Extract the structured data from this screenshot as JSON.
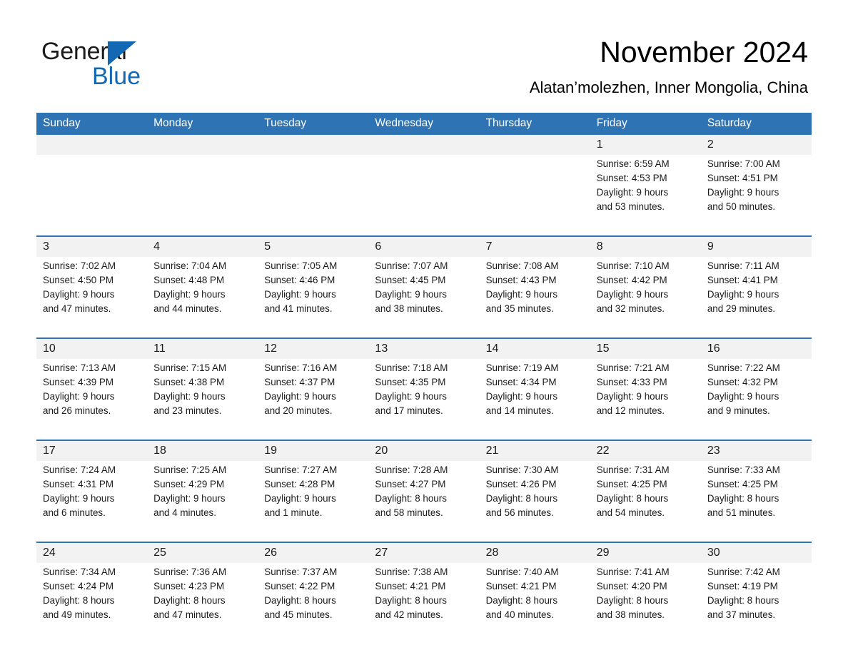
{
  "brand": {
    "name_part1": "General",
    "name_part2": "Blue",
    "accent_color": "#1268b3"
  },
  "header": {
    "title": "November 2024",
    "subtitle": "Alatan’molezhen, Inner Mongolia, China"
  },
  "colors": {
    "header_band": "#2e74b5",
    "date_band": "#f2f2f2",
    "text": "#1a1a1a"
  },
  "weekdays": [
    "Sunday",
    "Monday",
    "Tuesday",
    "Wednesday",
    "Thursday",
    "Friday",
    "Saturday"
  ],
  "weeks": [
    {
      "days": [
        {
          "date": "",
          "sunrise": "",
          "sunset": "",
          "daylight_line1": "",
          "daylight_line2": ""
        },
        {
          "date": "",
          "sunrise": "",
          "sunset": "",
          "daylight_line1": "",
          "daylight_line2": ""
        },
        {
          "date": "",
          "sunrise": "",
          "sunset": "",
          "daylight_line1": "",
          "daylight_line2": ""
        },
        {
          "date": "",
          "sunrise": "",
          "sunset": "",
          "daylight_line1": "",
          "daylight_line2": ""
        },
        {
          "date": "",
          "sunrise": "",
          "sunset": "",
          "daylight_line1": "",
          "daylight_line2": ""
        },
        {
          "date": "1",
          "sunrise": "Sunrise: 6:59 AM",
          "sunset": "Sunset: 4:53 PM",
          "daylight_line1": "Daylight: 9 hours",
          "daylight_line2": "and 53 minutes."
        },
        {
          "date": "2",
          "sunrise": "Sunrise: 7:00 AM",
          "sunset": "Sunset: 4:51 PM",
          "daylight_line1": "Daylight: 9 hours",
          "daylight_line2": "and 50 minutes."
        }
      ]
    },
    {
      "days": [
        {
          "date": "3",
          "sunrise": "Sunrise: 7:02 AM",
          "sunset": "Sunset: 4:50 PM",
          "daylight_line1": "Daylight: 9 hours",
          "daylight_line2": "and 47 minutes."
        },
        {
          "date": "4",
          "sunrise": "Sunrise: 7:04 AM",
          "sunset": "Sunset: 4:48 PM",
          "daylight_line1": "Daylight: 9 hours",
          "daylight_line2": "and 44 minutes."
        },
        {
          "date": "5",
          "sunrise": "Sunrise: 7:05 AM",
          "sunset": "Sunset: 4:46 PM",
          "daylight_line1": "Daylight: 9 hours",
          "daylight_line2": "and 41 minutes."
        },
        {
          "date": "6",
          "sunrise": "Sunrise: 7:07 AM",
          "sunset": "Sunset: 4:45 PM",
          "daylight_line1": "Daylight: 9 hours",
          "daylight_line2": "and 38 minutes."
        },
        {
          "date": "7",
          "sunrise": "Sunrise: 7:08 AM",
          "sunset": "Sunset: 4:43 PM",
          "daylight_line1": "Daylight: 9 hours",
          "daylight_line2": "and 35 minutes."
        },
        {
          "date": "8",
          "sunrise": "Sunrise: 7:10 AM",
          "sunset": "Sunset: 4:42 PM",
          "daylight_line1": "Daylight: 9 hours",
          "daylight_line2": "and 32 minutes."
        },
        {
          "date": "9",
          "sunrise": "Sunrise: 7:11 AM",
          "sunset": "Sunset: 4:41 PM",
          "daylight_line1": "Daylight: 9 hours",
          "daylight_line2": "and 29 minutes."
        }
      ]
    },
    {
      "days": [
        {
          "date": "10",
          "sunrise": "Sunrise: 7:13 AM",
          "sunset": "Sunset: 4:39 PM",
          "daylight_line1": "Daylight: 9 hours",
          "daylight_line2": "and 26 minutes."
        },
        {
          "date": "11",
          "sunrise": "Sunrise: 7:15 AM",
          "sunset": "Sunset: 4:38 PM",
          "daylight_line1": "Daylight: 9 hours",
          "daylight_line2": "and 23 minutes."
        },
        {
          "date": "12",
          "sunrise": "Sunrise: 7:16 AM",
          "sunset": "Sunset: 4:37 PM",
          "daylight_line1": "Daylight: 9 hours",
          "daylight_line2": "and 20 minutes."
        },
        {
          "date": "13",
          "sunrise": "Sunrise: 7:18 AM",
          "sunset": "Sunset: 4:35 PM",
          "daylight_line1": "Daylight: 9 hours",
          "daylight_line2": "and 17 minutes."
        },
        {
          "date": "14",
          "sunrise": "Sunrise: 7:19 AM",
          "sunset": "Sunset: 4:34 PM",
          "daylight_line1": "Daylight: 9 hours",
          "daylight_line2": "and 14 minutes."
        },
        {
          "date": "15",
          "sunrise": "Sunrise: 7:21 AM",
          "sunset": "Sunset: 4:33 PM",
          "daylight_line1": "Daylight: 9 hours",
          "daylight_line2": "and 12 minutes."
        },
        {
          "date": "16",
          "sunrise": "Sunrise: 7:22 AM",
          "sunset": "Sunset: 4:32 PM",
          "daylight_line1": "Daylight: 9 hours",
          "daylight_line2": "and 9 minutes."
        }
      ]
    },
    {
      "days": [
        {
          "date": "17",
          "sunrise": "Sunrise: 7:24 AM",
          "sunset": "Sunset: 4:31 PM",
          "daylight_line1": "Daylight: 9 hours",
          "daylight_line2": "and 6 minutes."
        },
        {
          "date": "18",
          "sunrise": "Sunrise: 7:25 AM",
          "sunset": "Sunset: 4:29 PM",
          "daylight_line1": "Daylight: 9 hours",
          "daylight_line2": "and 4 minutes."
        },
        {
          "date": "19",
          "sunrise": "Sunrise: 7:27 AM",
          "sunset": "Sunset: 4:28 PM",
          "daylight_line1": "Daylight: 9 hours",
          "daylight_line2": "and 1 minute."
        },
        {
          "date": "20",
          "sunrise": "Sunrise: 7:28 AM",
          "sunset": "Sunset: 4:27 PM",
          "daylight_line1": "Daylight: 8 hours",
          "daylight_line2": "and 58 minutes."
        },
        {
          "date": "21",
          "sunrise": "Sunrise: 7:30 AM",
          "sunset": "Sunset: 4:26 PM",
          "daylight_line1": "Daylight: 8 hours",
          "daylight_line2": "and 56 minutes."
        },
        {
          "date": "22",
          "sunrise": "Sunrise: 7:31 AM",
          "sunset": "Sunset: 4:25 PM",
          "daylight_line1": "Daylight: 8 hours",
          "daylight_line2": "and 54 minutes."
        },
        {
          "date": "23",
          "sunrise": "Sunrise: 7:33 AM",
          "sunset": "Sunset: 4:25 PM",
          "daylight_line1": "Daylight: 8 hours",
          "daylight_line2": "and 51 minutes."
        }
      ]
    },
    {
      "days": [
        {
          "date": "24",
          "sunrise": "Sunrise: 7:34 AM",
          "sunset": "Sunset: 4:24 PM",
          "daylight_line1": "Daylight: 8 hours",
          "daylight_line2": "and 49 minutes."
        },
        {
          "date": "25",
          "sunrise": "Sunrise: 7:36 AM",
          "sunset": "Sunset: 4:23 PM",
          "daylight_line1": "Daylight: 8 hours",
          "daylight_line2": "and 47 minutes."
        },
        {
          "date": "26",
          "sunrise": "Sunrise: 7:37 AM",
          "sunset": "Sunset: 4:22 PM",
          "daylight_line1": "Daylight: 8 hours",
          "daylight_line2": "and 45 minutes."
        },
        {
          "date": "27",
          "sunrise": "Sunrise: 7:38 AM",
          "sunset": "Sunset: 4:21 PM",
          "daylight_line1": "Daylight: 8 hours",
          "daylight_line2": "and 42 minutes."
        },
        {
          "date": "28",
          "sunrise": "Sunrise: 7:40 AM",
          "sunset": "Sunset: 4:21 PM",
          "daylight_line1": "Daylight: 8 hours",
          "daylight_line2": "and 40 minutes."
        },
        {
          "date": "29",
          "sunrise": "Sunrise: 7:41 AM",
          "sunset": "Sunset: 4:20 PM",
          "daylight_line1": "Daylight: 8 hours",
          "daylight_line2": "and 38 minutes."
        },
        {
          "date": "30",
          "sunrise": "Sunrise: 7:42 AM",
          "sunset": "Sunset: 4:19 PM",
          "daylight_line1": "Daylight: 8 hours",
          "daylight_line2": "and 37 minutes."
        }
      ]
    }
  ]
}
